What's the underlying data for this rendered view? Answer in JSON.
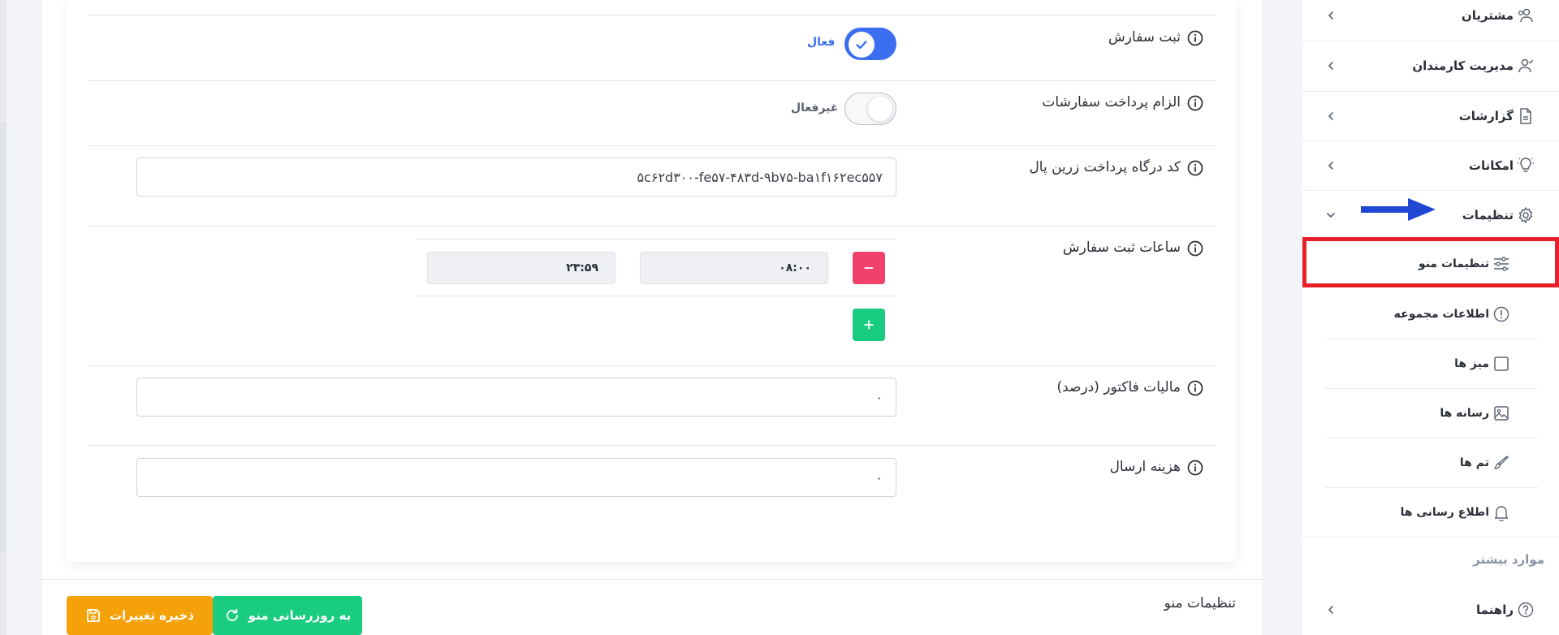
{
  "colors": {
    "accent": "#3b6ff0",
    "danger": "#f0416c",
    "success": "#19cc7f",
    "warning": "#f5a20a",
    "highlight": "#e8202a"
  },
  "settings": {
    "order_registration": {
      "label": "ثبت سفارش",
      "state_text": "فعال",
      "enabled": true
    },
    "payment_required": {
      "label": "الزام پرداخت سفارشات",
      "state_text": "غیرفعال",
      "enabled": false
    },
    "zarinpal_code": {
      "label": "کد درگاه پرداخت زرین پال",
      "value": "۵c۶۲d۳۰۰-fe۵۷-۴۸۳d-۹b۷۵-ba۱f۱۶۲ec۵۵۷"
    },
    "order_hours": {
      "label": "ساعات ثبت سفارش",
      "from": "۰۸:۰۰",
      "to": "۲۳:۵۹"
    },
    "invoice_tax": {
      "label": "مالیات فاکتور (درصد)",
      "value": "۰"
    },
    "shipping_cost": {
      "label": "هزینه ارسال",
      "value": "۰"
    }
  },
  "footer": {
    "title": "تنظیمات منو",
    "refresh_label": "به روزرسانی منو",
    "save_label": "ذخیره تغییرات"
  },
  "sidebar": {
    "items": [
      {
        "label": "مشتریان",
        "icon": "users-icon"
      },
      {
        "label": "مدیریت کارمندان",
        "icon": "user-check-icon"
      },
      {
        "label": "گزارشات",
        "icon": "document-icon"
      },
      {
        "label": "امکانات",
        "icon": "bulb-icon"
      },
      {
        "label": "تنظیمات",
        "icon": "gear-icon",
        "expanded": true
      }
    ],
    "sub_items": [
      {
        "label": "تنظیمات منو",
        "icon": "sliders-icon",
        "active": true
      },
      {
        "label": "اطلاعات مجموعه",
        "icon": "info-icon"
      },
      {
        "label": "میز ها",
        "icon": "square-icon"
      },
      {
        "label": "رسانه ها",
        "icon": "image-icon"
      },
      {
        "label": "تم ها",
        "icon": "brush-icon"
      },
      {
        "label": "اطلاع رسانی ها",
        "icon": "bell-icon"
      }
    ],
    "more_label": "موارد بیشتر",
    "help": {
      "label": "راهنما",
      "icon": "help-icon"
    }
  }
}
